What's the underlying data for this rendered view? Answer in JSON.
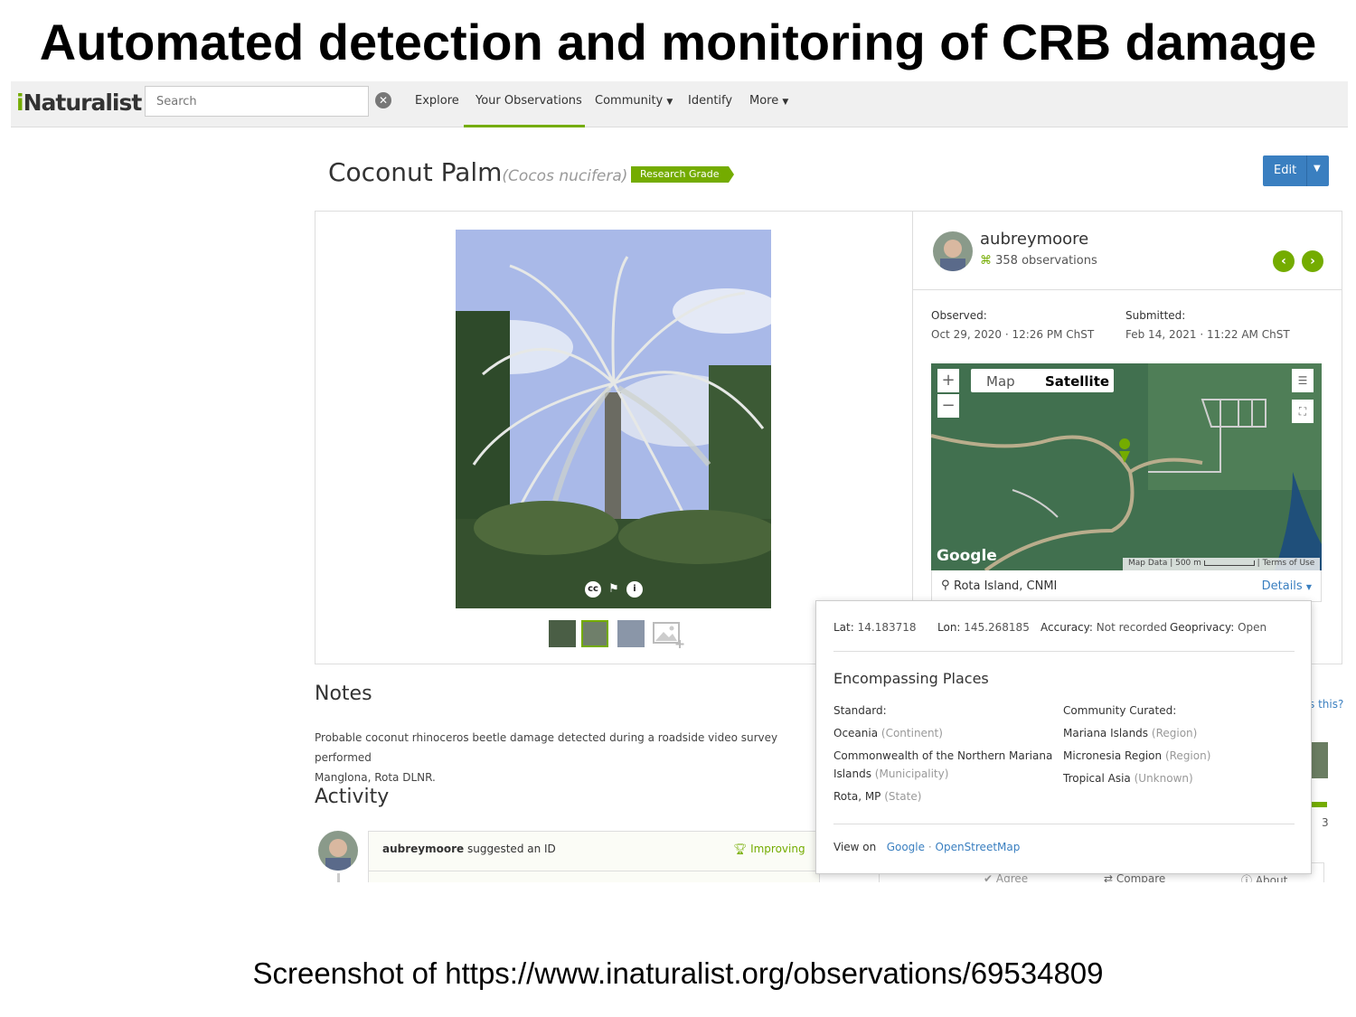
{
  "slide": {
    "title": "Automated detection and monitoring of CRB damage",
    "caption": "Screenshot of https://www.inaturalist.org/observations/69534809"
  },
  "header": {
    "logo_i": "i",
    "logo_rest": "Naturalist",
    "search_placeholder": "Search",
    "nav": [
      "Explore",
      "Your Observations",
      "Community",
      "Identify",
      "More"
    ],
    "active_nav": "Your Observations"
  },
  "observation": {
    "common_name": "Coconut Palm",
    "scientific_name": "(Cocos nucifera)",
    "quality_badge": "Research Grade",
    "edit_label": "Edit"
  },
  "photo": {
    "license_icons": [
      "cc-icon",
      "flag-icon",
      "info-icon"
    ],
    "thumbnail_count": 3
  },
  "observer": {
    "username": "aubreymoore",
    "observations": "358 observations",
    "observed_label": "Observed:",
    "observed_value": "Oct 29, 2020 · 12:26 PM ChST",
    "submitted_label": "Submitted:",
    "submitted_value": "Feb 14, 2021 · 11:22 AM ChST"
  },
  "map": {
    "tab_map": "Map",
    "tab_satellite": "Satellite",
    "active_tab": "Satellite",
    "google": "Google",
    "map_data": "Map Data",
    "scale": "500 m",
    "terms": "Terms of Use",
    "place": "Rota Island, CNMI",
    "details": "Details"
  },
  "notes": {
    "heading": "Notes",
    "text_line1": "Probable coconut rhinoceros beetle damage detected during a roadside video survey performed",
    "text_line2": "Manglona, Rota DLNR."
  },
  "activity": {
    "heading": "Activity",
    "user": "aubreymoore",
    "action": "suggested an ID",
    "status": "Improving",
    "behind_text": "s this?",
    "behind_count": "3",
    "behind_agree": "Agree",
    "behind_compare": "Compare",
    "behind_about": "About"
  },
  "popup": {
    "lat_label": "Lat:",
    "lat_value": "14.183718",
    "lon_label": "Lon:",
    "lon_value": "145.268185",
    "acc_label": "Accuracy:",
    "acc_value": "Not recorded",
    "geo_label": "Geoprivacy:",
    "geo_value": "Open",
    "encompassing": "Encompassing Places",
    "standard_label": "Standard:",
    "standard": [
      {
        "name": "Oceania",
        "type": "(Continent)"
      },
      {
        "name": "Commonwealth of the Northern Mariana",
        "name2": "Islands",
        "type": "(Municipality)"
      },
      {
        "name": "Rota, MP",
        "type": "(State)"
      }
    ],
    "community_label": "Community Curated:",
    "community": [
      {
        "name": "Mariana Islands",
        "type": "(Region)"
      },
      {
        "name": "Micronesia Region",
        "type": "(Region)"
      },
      {
        "name": "Tropical Asia",
        "type": "(Unknown)"
      }
    ],
    "view_on": "View on",
    "link_google": "Google",
    "link_sep": "·",
    "link_osm": "OpenStreetMap"
  },
  "colors": {
    "brand_green": "#74ac00",
    "link_blue": "#3a7fc0"
  }
}
